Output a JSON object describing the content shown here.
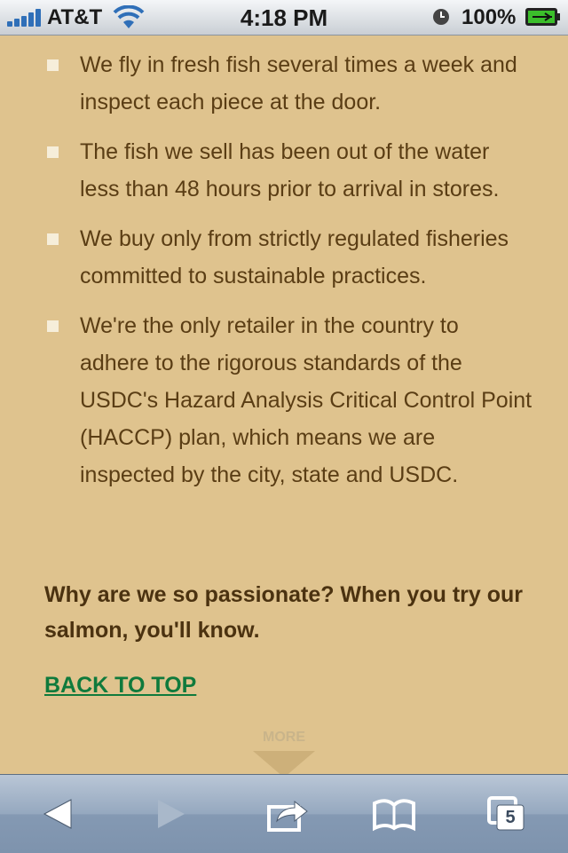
{
  "status_bar": {
    "carrier": "AT&T",
    "time": "4:18 PM",
    "battery": "100%"
  },
  "bullets": [
    "We fly in fresh fish several times a week and inspect each piece at the door.",
    "The fish we sell has been out of the water less than 48 hours prior to arrival in stores.",
    "We buy only from strictly regulated fisheries committed to sustainable practices.",
    "We're the only retailer in the country to adhere to the rigorous standards of the USDC's Hazard Analysis Critical Control Point (HACCP) plan, which means we are inspected by the city, state and USDC."
  ],
  "passion_text": "Why are we so passionate? When you try our salmon, you'll know.",
  "back_to_top": "BACK TO TOP",
  "more_label": "MORE",
  "toolbar": {
    "tabs_count": "5"
  },
  "colors": {
    "background": "#dfc38e",
    "body_text": "#5a3d14",
    "link": "#0f7a3c"
  }
}
